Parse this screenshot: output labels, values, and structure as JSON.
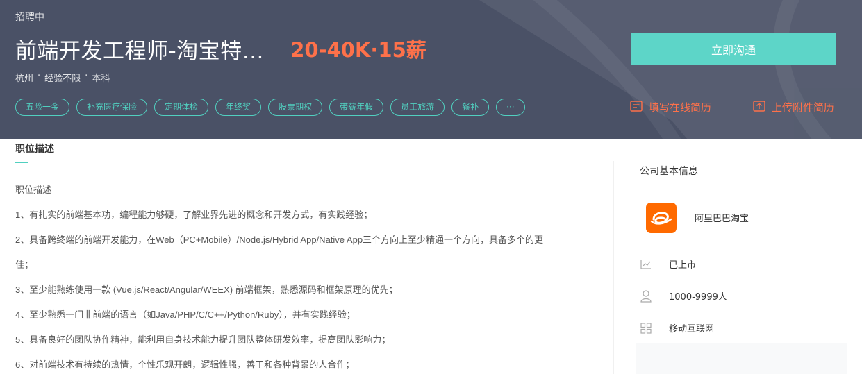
{
  "header": {
    "status": "招聘中",
    "job_title": "前端开发工程师-淘宝特…",
    "salary": "20-40K·15薪",
    "meta": {
      "city": "杭州",
      "experience": "经验不限",
      "education": "本科",
      "separator": "·"
    },
    "tags": [
      "五险一金",
      "补充医疗保险",
      "定期体检",
      "年终奖",
      "股票期权",
      "带薪年假",
      "员工旅游",
      "餐补",
      "···"
    ],
    "chat_button": "立即沟通",
    "fill_resume": "填写在线简历",
    "upload_resume": "上传附件简历"
  },
  "description": {
    "section_title": "职位描述",
    "lines": [
      "职位描述",
      "1、有扎实的前端基本功，编程能力够硬，了解业界先进的概念和开发方式，有实践经验；",
      "2、具备跨终端的前端开发能力，在Web（PC+Mobile）/Node.js/Hybrid App/Native App三个方向上至少精通一个方向，具备多个的更",
      "佳；",
      "3、至少能熟练使用一款 (Vue.js/React/Angular/WEEX) 前端框架，熟悉源码和框架原理的优先；",
      "4、至少熟悉一门非前端的语言（如Java/PHP/C/C++/Python/Ruby），并有实践经验；",
      "5、具备良好的团队协作精神，能利用自身技术能力提升团队整体研发效率，提高团队影响力；",
      "6、对前端技术有持续的热情，个性乐观开朗，逻辑性强，善于和各种背景的人合作；"
    ]
  },
  "company": {
    "heading": "公司基本信息",
    "name": "阿里巴巴淘宝",
    "stage": "已上市",
    "size": "1000-9999人",
    "industry": "移动互联网"
  },
  "colors": {
    "banner": "#4a5166",
    "accent": "#51d0c0",
    "button": "#5dd5c8",
    "salary": "#fe714a",
    "logo": "#ff6a00"
  }
}
